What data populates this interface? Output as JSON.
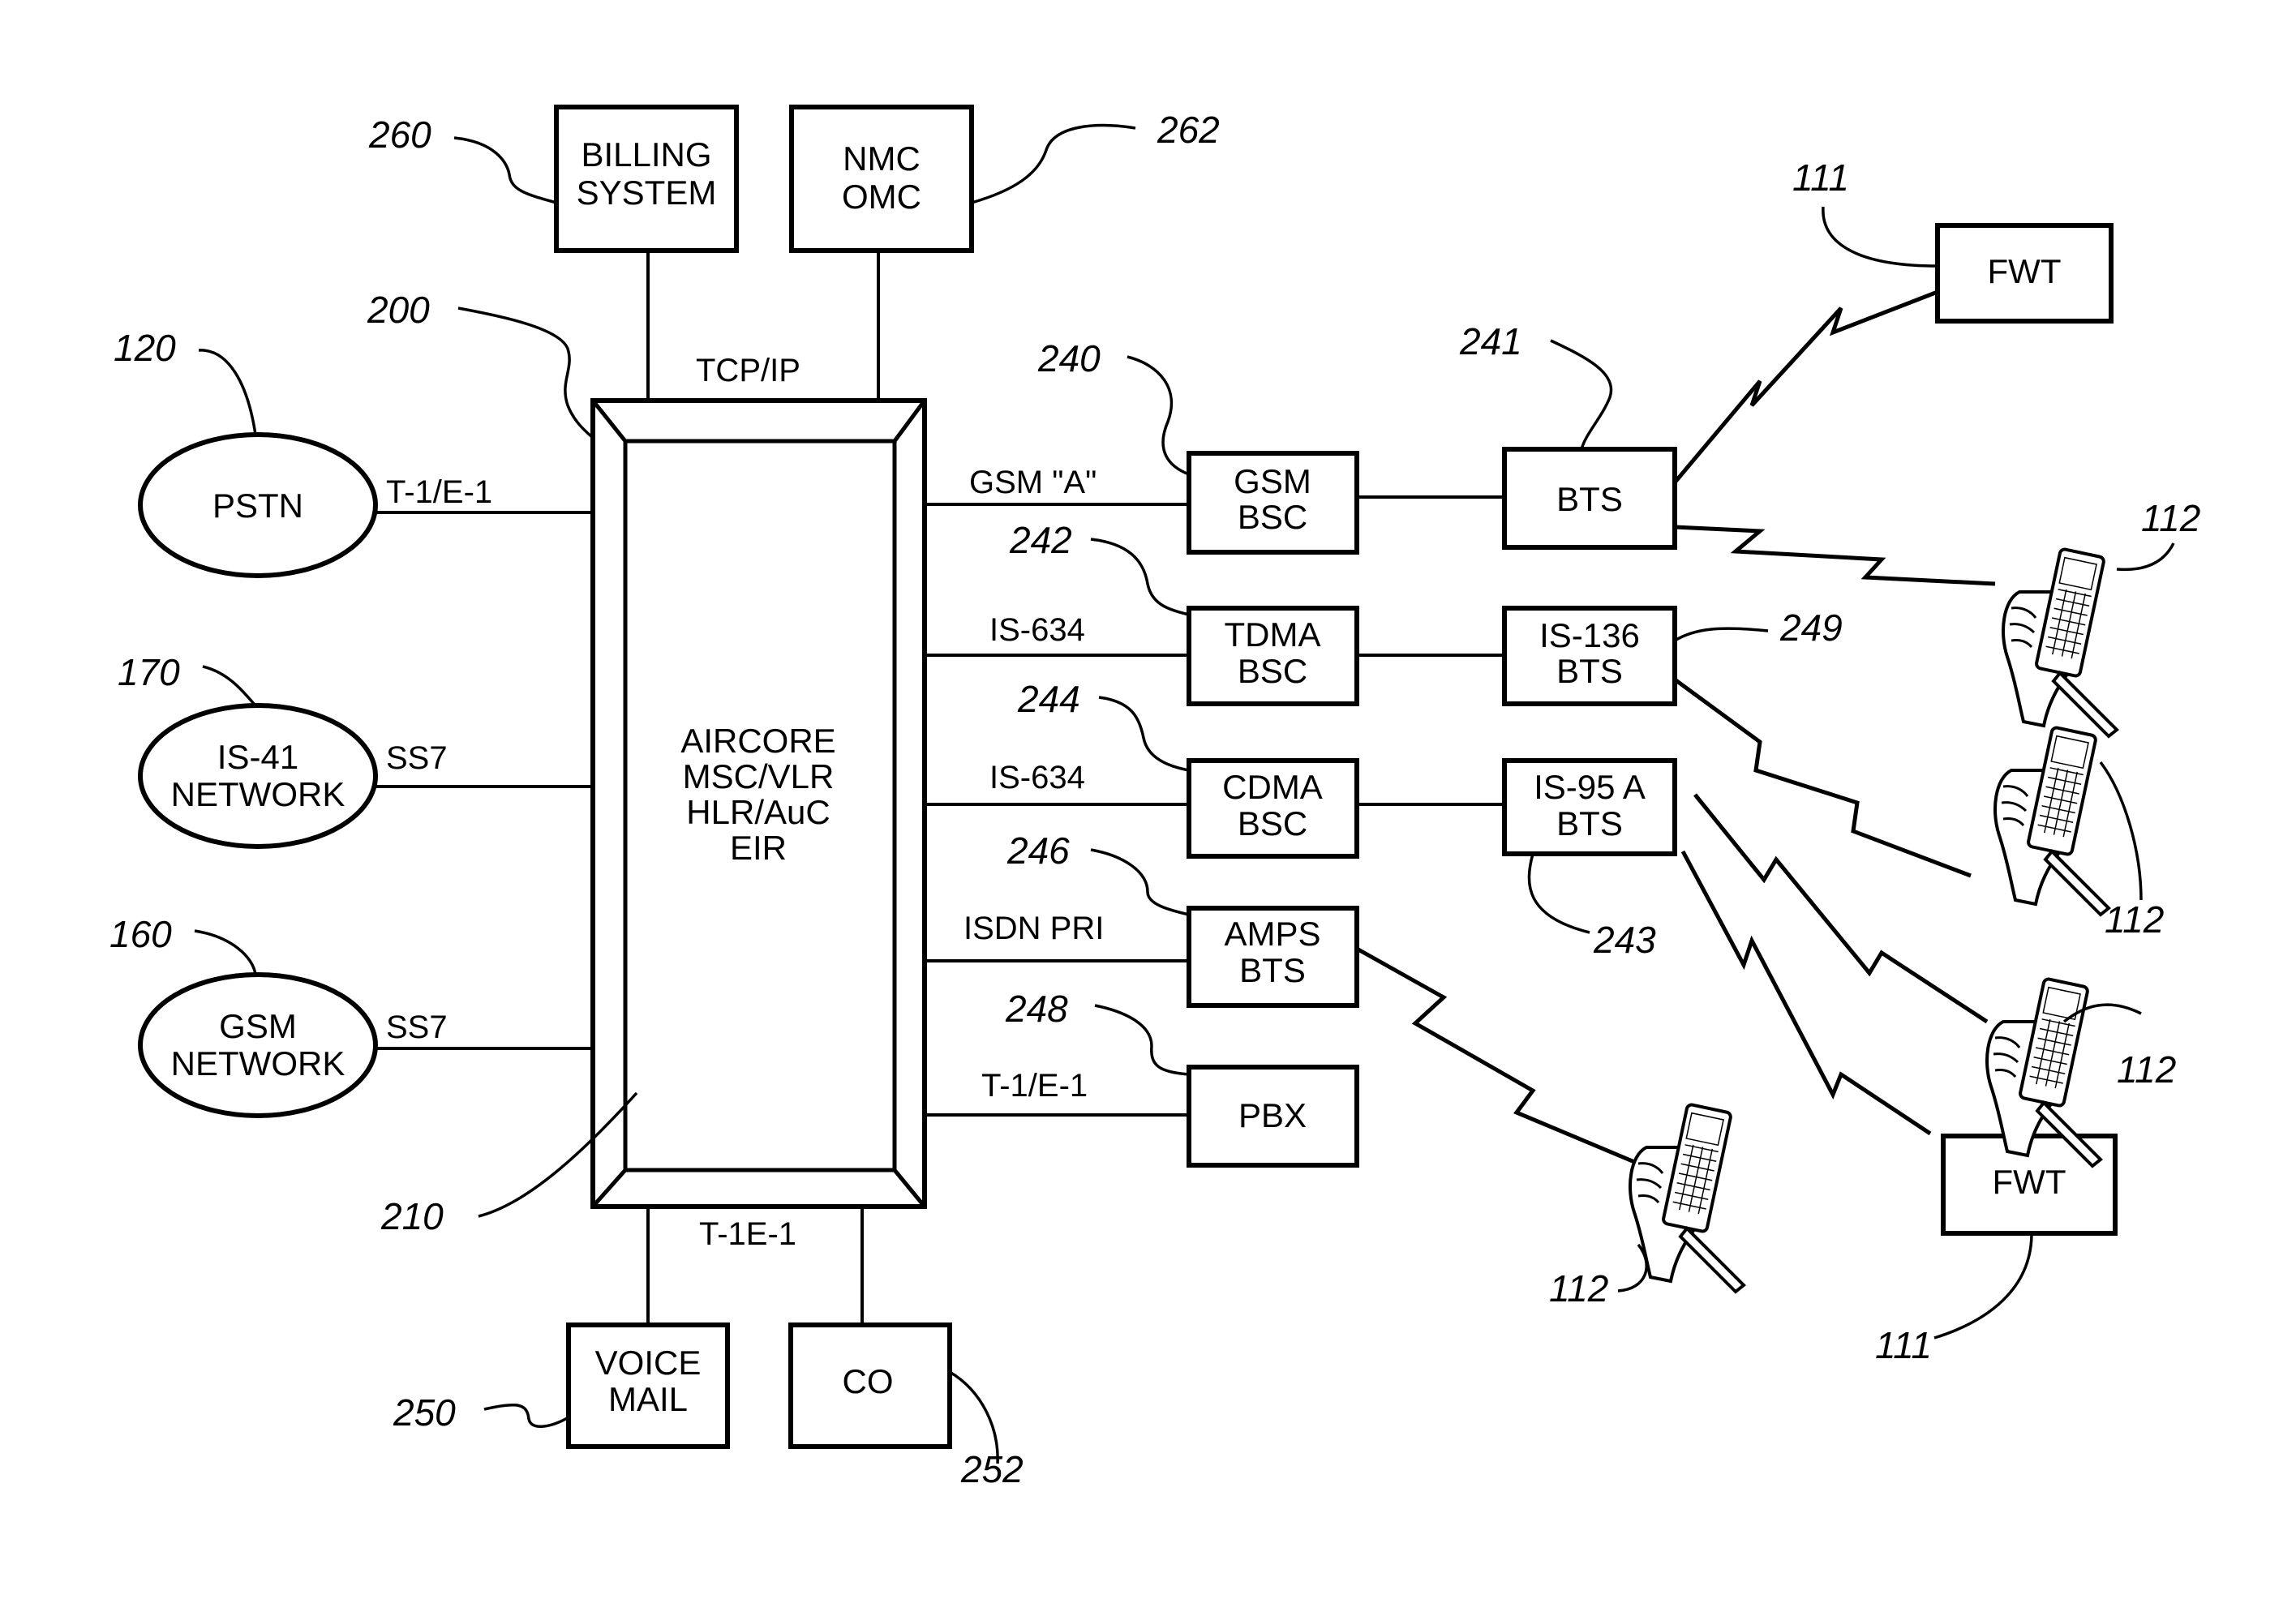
{
  "figure": {
    "central": {
      "ref": "200",
      "inner_ref": "210",
      "lines": [
        "AIRCORE",
        "MSC/VLR",
        "HLR/AuC",
        "EIR"
      ]
    },
    "top": {
      "billing": {
        "ref": "260",
        "lines": [
          "BILLING",
          "SYSTEM"
        ]
      },
      "nmc": {
        "ref": "262",
        "lines": [
          "NMC",
          "OMC"
        ]
      },
      "link_label": "TCP/IP"
    },
    "left_networks": [
      {
        "ref": "120",
        "lines": [
          "PSTN"
        ],
        "link_label": "T-1/E-1"
      },
      {
        "ref": "170",
        "lines": [
          "IS-41",
          "NETWORK"
        ],
        "link_label": "SS7"
      },
      {
        "ref": "160",
        "lines": [
          "GSM",
          "NETWORK"
        ],
        "link_label": "SS7"
      }
    ],
    "controllers": [
      {
        "ref": "240",
        "lines": [
          "GSM",
          "BSC"
        ],
        "link_label": "GSM \"A\""
      },
      {
        "ref": "242",
        "lines": [
          "TDMA",
          "BSC"
        ],
        "link_label": "IS-634"
      },
      {
        "ref": "244",
        "lines": [
          "CDMA",
          "BSC"
        ],
        "link_label": "IS-634"
      },
      {
        "ref": "246",
        "lines": [
          "AMPS",
          "BTS"
        ],
        "link_label": "ISDN PRI"
      },
      {
        "ref": "248",
        "lines": [
          "PBX"
        ],
        "link_label": "T-1/E-1"
      }
    ],
    "base_stations": [
      {
        "ref": "241",
        "lines": [
          "BTS"
        ]
      },
      {
        "ref": "249",
        "lines": [
          "IS-136",
          "BTS"
        ]
      },
      {
        "ref": "243",
        "lines": [
          "IS-95 A",
          "BTS"
        ]
      }
    ],
    "terminals": {
      "fwt_top": {
        "ref": "111",
        "label": "FWT"
      },
      "fwt_bottom": {
        "ref": "111",
        "label": "FWT"
      },
      "handsets": [
        {
          "ref": "112"
        },
        {
          "ref": "112"
        },
        {
          "ref": "112"
        },
        {
          "ref": "112"
        }
      ]
    },
    "bottom": {
      "voice_mail": {
        "ref": "250",
        "lines": [
          "VOICE",
          "MAIL"
        ]
      },
      "co": {
        "ref": "252",
        "lines": [
          "CO"
        ]
      },
      "link_label": "T-1E-1"
    }
  }
}
